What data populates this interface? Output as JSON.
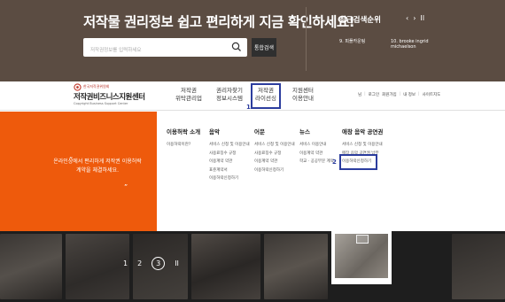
{
  "hero": {
    "title": "저작물 권리정보 쉽고 편리하게 지금 확인하세요!",
    "search_placeholder": "저작권정보를 입력하세요",
    "search_button": "통합검색",
    "recent": {
      "title": "최근검색순위",
      "prev": "‹",
      "next": "›",
      "pause": "II",
      "items": [
        "9. 피플카운팅",
        "10. brooke ingrid michaelson"
      ]
    }
  },
  "logo": {
    "org": "한국저작권위원회",
    "name": "저작권비즈니스지원센터",
    "english": "Copyright Business Support Center"
  },
  "gnb": {
    "items": [
      {
        "line1": "저작권",
        "line2": "위탁관리업"
      },
      {
        "line1": "권리자찾기",
        "line2": "정보시스템"
      },
      {
        "line1": "저작권",
        "line2": "라이선싱"
      },
      {
        "line1": "지원센터",
        "line2": "이용안내"
      }
    ],
    "util": [
      "로그인",
      "회원가입",
      "내 정보",
      "사이트지도"
    ],
    "util_prefix": "님"
  },
  "annotations": {
    "step1": "1",
    "step2": "2"
  },
  "mega_menu": {
    "quote": "온라인상에서 편리하게 저작권 이용허락 계약을 체결하세요.",
    "columns": [
      {
        "head": "이용허락 소개",
        "links": [
          "이용허락이란?"
        ]
      },
      {
        "head": "음악",
        "links": [
          "서비스 신청 및 이용안내",
          "사용료징수 규정",
          "이용계약 약관",
          "표준계약서",
          "이용허락신청하기"
        ]
      },
      {
        "head": "어문",
        "links": [
          "서비스 신청 및 이용안내",
          "사용료징수 규정",
          "이용계약 약관",
          "이용허락신청하기"
        ]
      },
      {
        "head": "뉴스",
        "links": [
          "서비스 이용안내",
          "이용계약 약관",
          "학교 · 공공부문 계약"
        ]
      },
      {
        "head": "애창 음악 공연권",
        "links": [
          "서비스 신청 및 이용안내",
          "매장 음악 공연권 납부",
          "이용허락신청하기"
        ]
      }
    ]
  },
  "slider": {
    "pages": [
      "1",
      "2",
      "3"
    ],
    "current": "3",
    "pause": "II"
  },
  "colors": {
    "hero_bg": "#5b4c42",
    "accent_orange": "#ee5a0c",
    "highlight_blue": "#2c3d9e"
  }
}
